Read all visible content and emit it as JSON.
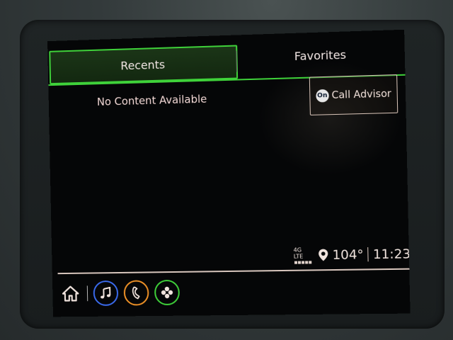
{
  "tabs": [
    {
      "label": "Recents",
      "active": true
    },
    {
      "label": "Favorites",
      "active": false
    }
  ],
  "content": {
    "empty_message": "No Content Available"
  },
  "call_advisor": {
    "badge": "On",
    "label": "Call Advisor"
  },
  "status": {
    "network": "4G LTE",
    "signal_bars": 5,
    "temperature": "104°",
    "time": "11:23"
  },
  "dock": {
    "items": [
      {
        "icon": "home-icon"
      },
      {
        "icon": "music-note-icon",
        "color": "#3b6cf0"
      },
      {
        "icon": "phone-icon",
        "color": "#f09227"
      },
      {
        "icon": "apps-plus-icon",
        "color": "#3fd23a"
      }
    ]
  },
  "colors": {
    "accent_green": "#3fd23a",
    "text": "#f2e6e4",
    "background": "#050607"
  }
}
